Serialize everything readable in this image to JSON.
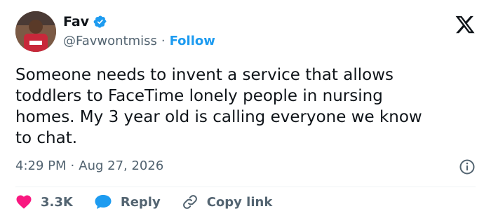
{
  "author": {
    "name": "Fav",
    "handle": "@Favwontmiss",
    "follow_label": "Follow"
  },
  "tweet": {
    "text": "Someone needs to invent a service that allows\ntoddlers to FaceTime lonely people in nursing\nhomes. My 3 year old is calling everyone we know\nto chat.",
    "time": "4:29 PM",
    "date": "Aug 27, 2026"
  },
  "actions": {
    "likes": "3.3K",
    "reply_label": "Reply",
    "copy_label": "Copy link"
  },
  "colors": {
    "accent": "#1d9bf0",
    "like": "#f91880",
    "muted": "#536471"
  },
  "icons": [
    "verified-badge-icon",
    "x-logo-icon",
    "info-icon",
    "heart-icon",
    "reply-bubble-icon",
    "link-icon"
  ]
}
